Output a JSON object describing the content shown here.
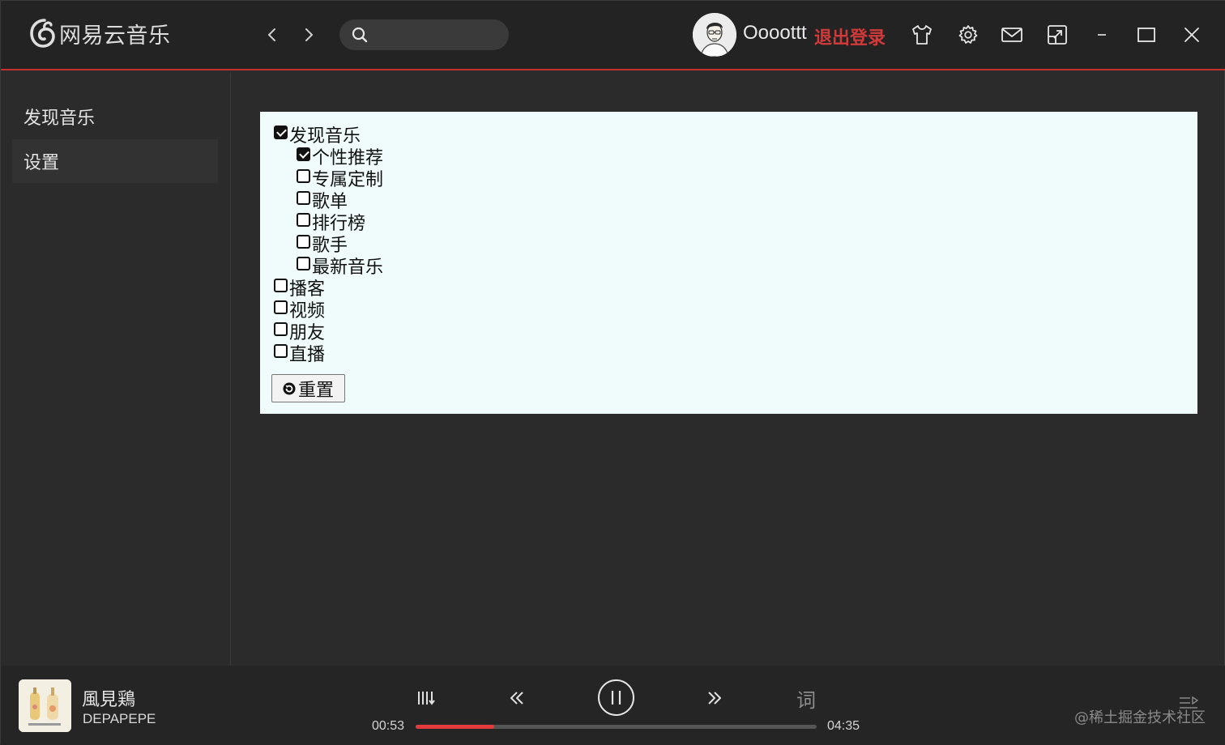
{
  "app": {
    "name": "网易云音乐",
    "colors": {
      "accent": "#c62f2f",
      "header_bg": "#232323",
      "body_bg": "#2b2b2b",
      "panel_bg": "#f0fcfc"
    }
  },
  "header": {
    "search": {
      "value": "",
      "placeholder": ""
    },
    "user": {
      "name": "Oooottt",
      "logout_label": "退出登录"
    },
    "icons": [
      "back-icon",
      "forward-icon",
      "search-icon",
      "skin-shirt-icon",
      "settings-gear-icon",
      "mail-icon",
      "mini-mode-icon",
      "minimize-icon",
      "maximize-icon",
      "close-icon"
    ]
  },
  "sidebar": {
    "items": [
      {
        "label": "发现音乐",
        "active": false
      },
      {
        "label": "设置",
        "active": true
      }
    ]
  },
  "settings": {
    "groups": [
      {
        "label": "发现音乐",
        "checked": true
      },
      {
        "label": "个性推荐",
        "checked": true
      },
      {
        "label": "专属定制",
        "checked": false
      },
      {
        "label": "歌单",
        "checked": false
      },
      {
        "label": "排行榜",
        "checked": false
      },
      {
        "label": "歌手",
        "checked": false
      },
      {
        "label": "最新音乐",
        "checked": false
      },
      {
        "label": "播客",
        "checked": false
      },
      {
        "label": "视频",
        "checked": false
      },
      {
        "label": "朋友",
        "checked": false
      },
      {
        "label": "直播",
        "checked": false
      }
    ],
    "reset_label": "重置"
  },
  "player": {
    "song_title": "風見鶏",
    "artist": "DEPAPEPE",
    "current_time": "00:53",
    "total_time": "04:35",
    "progress": 0.195,
    "lyric_label": "词",
    "state": "playing"
  },
  "watermark": "@稀土掘金技术社区"
}
